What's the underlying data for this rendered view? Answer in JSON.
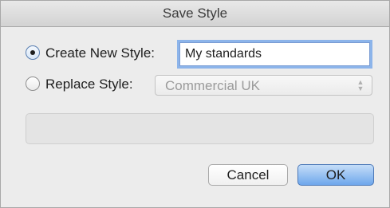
{
  "window": {
    "title": "Save Style"
  },
  "create": {
    "label": "Create New Style:",
    "selected": true,
    "input_value": "My standards"
  },
  "replace": {
    "label": "Replace Style:",
    "selected": false,
    "select_value": "Commercial UK"
  },
  "description": {
    "text": ""
  },
  "buttons": {
    "cancel": "Cancel",
    "ok": "OK"
  },
  "colors": {
    "focus_ring": "#8cb4ea",
    "default_button": "#6ea7ec"
  }
}
